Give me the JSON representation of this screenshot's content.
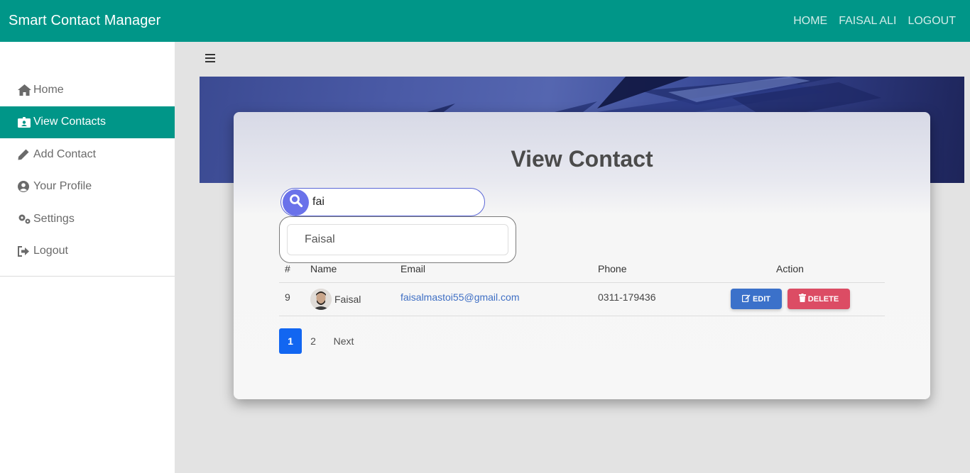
{
  "navbar": {
    "brand": "Smart Contact Manager",
    "links": [
      "HOME",
      "FAISAL ALI",
      "LOGOUT"
    ],
    "bg_color": "#009688"
  },
  "sidebar": {
    "items": [
      {
        "label": "Home",
        "icon": "home-icon",
        "active": false
      },
      {
        "label": "View Contacts",
        "icon": "id-card-icon",
        "active": true
      },
      {
        "label": "Add Contact",
        "icon": "pencil-icon",
        "active": false
      },
      {
        "label": "Your Profile",
        "icon": "user-circle-icon",
        "active": false
      },
      {
        "label": "Settings",
        "icon": "cogs-icon",
        "active": false
      },
      {
        "label": "Logout",
        "icon": "sign-out-icon",
        "active": false
      }
    ]
  },
  "content": {
    "menu_icon": "hamburger-icon",
    "title": "View Contact",
    "search": {
      "value": "fai",
      "icon": "search-icon"
    },
    "suggestions": [
      "Faisal"
    ],
    "table": {
      "headers": [
        "#",
        "Name",
        "Email",
        "Phone",
        "Action"
      ],
      "rows": [
        {
          "id": "9",
          "name": "Faisal",
          "email": "faisalmastoi55@gmail.com",
          "phone": "0311-179436",
          "edit_label": "EDIT",
          "delete_label": "DELETE"
        }
      ]
    },
    "pagination": {
      "pages": [
        "1",
        "2"
      ],
      "active": "1",
      "next": "Next"
    }
  },
  "colors": {
    "primary": "#009688",
    "edit": "#3b71ca",
    "delete": "#dc4c64",
    "page_active": "#1266f1"
  }
}
